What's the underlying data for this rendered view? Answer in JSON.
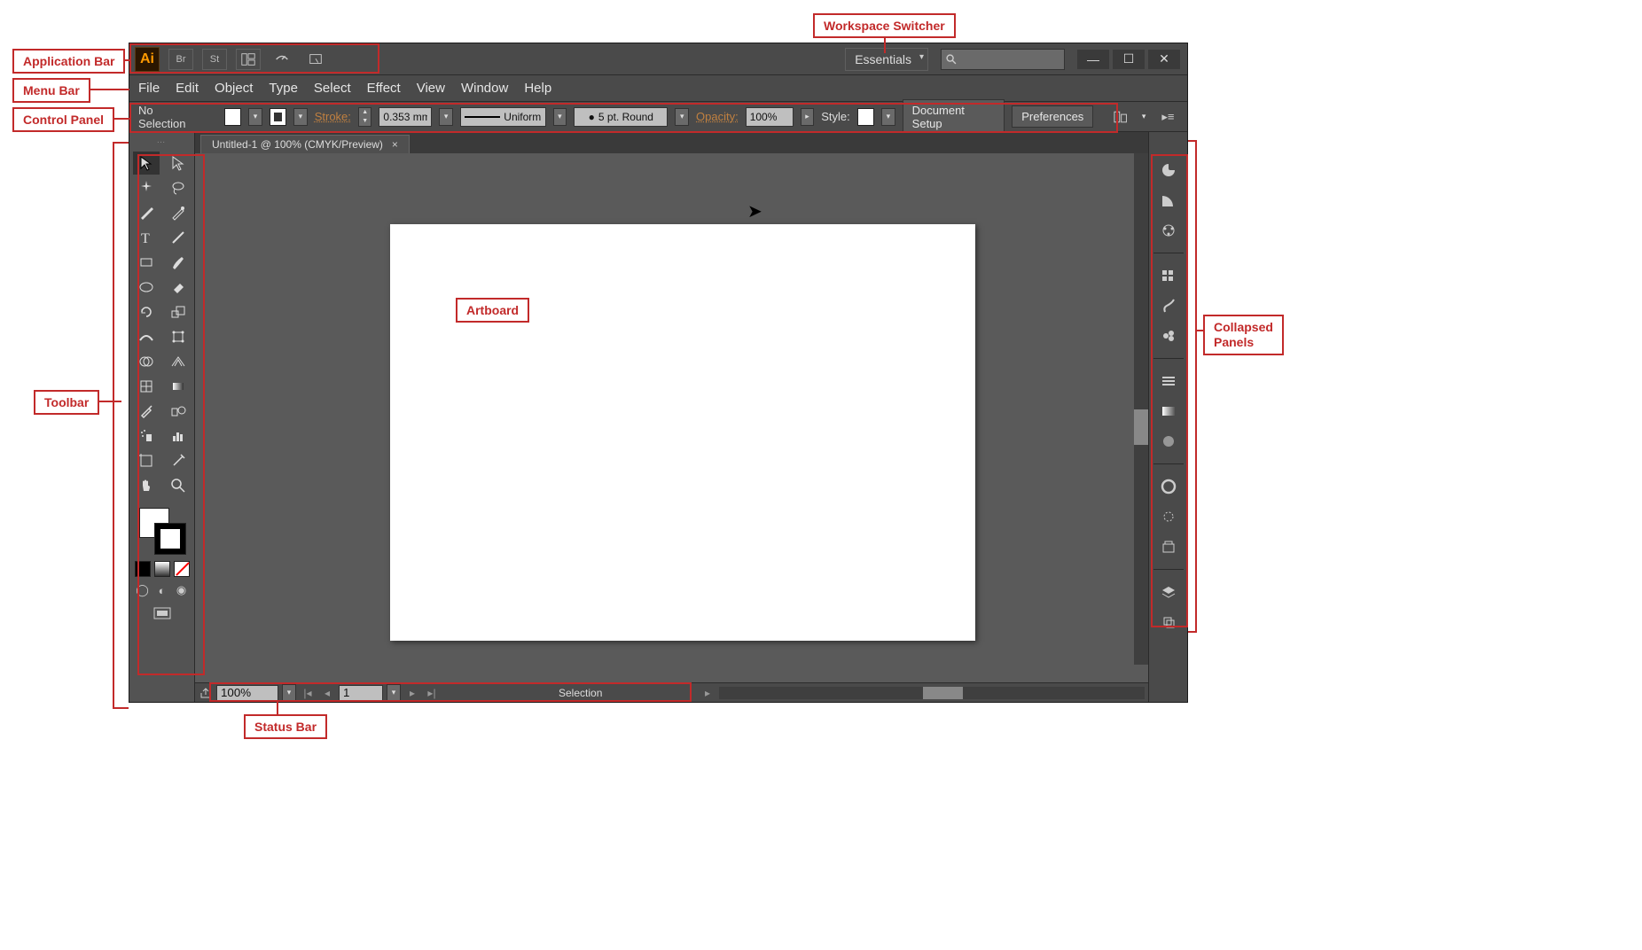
{
  "callouts": {
    "application_bar": "Application Bar",
    "menu_bar": "Menu Bar",
    "control_panel": "Control Panel",
    "workspace_switcher": "Workspace Switcher",
    "toolbar": "Toolbar",
    "artboard": "Artboard",
    "collapsed_panels": "Collapsed Panels",
    "status_bar": "Status Bar"
  },
  "app_bar": {
    "logo": "Ai",
    "br": "Br",
    "st": "St"
  },
  "workspace": {
    "label": "Essentials"
  },
  "menu": {
    "items": [
      "File",
      "Edit",
      "Object",
      "Type",
      "Select",
      "Effect",
      "View",
      "Window",
      "Help"
    ]
  },
  "control": {
    "selection": "No Selection",
    "stroke_label": "Stroke:",
    "stroke_value": "0.353 mm",
    "brush_line": "———",
    "brush_name": "Uniform",
    "width_profile": "5 pt. Round",
    "opacity_label": "Opacity:",
    "opacity_value": "100%",
    "style_label": "Style:",
    "doc_setup": "Document Setup",
    "prefs": "Preferences"
  },
  "doc": {
    "tab_title": "Untitled-1 @ 100% (CMYK/Preview)"
  },
  "status": {
    "zoom": "100%",
    "artboard_num": "1",
    "tool": "Selection"
  },
  "panels": {
    "names": [
      "color",
      "swatches",
      "brushes",
      "symbols",
      "stroke",
      "gradient",
      "transparency",
      "appearance",
      "graphic-styles",
      "layers",
      "artboards"
    ]
  },
  "tools": {
    "names": [
      "selection",
      "direct-selection",
      "magic-wand",
      "lasso",
      "pen",
      "curvature",
      "type",
      "line-segment",
      "rectangle",
      "paintbrush",
      "shaper",
      "eraser",
      "rotate",
      "scale",
      "width",
      "free-transform",
      "shape-builder",
      "perspective-grid",
      "mesh",
      "gradient",
      "eyedropper",
      "blend",
      "symbol-sprayer",
      "column-graph",
      "artboard",
      "slice",
      "hand",
      "zoom"
    ]
  }
}
